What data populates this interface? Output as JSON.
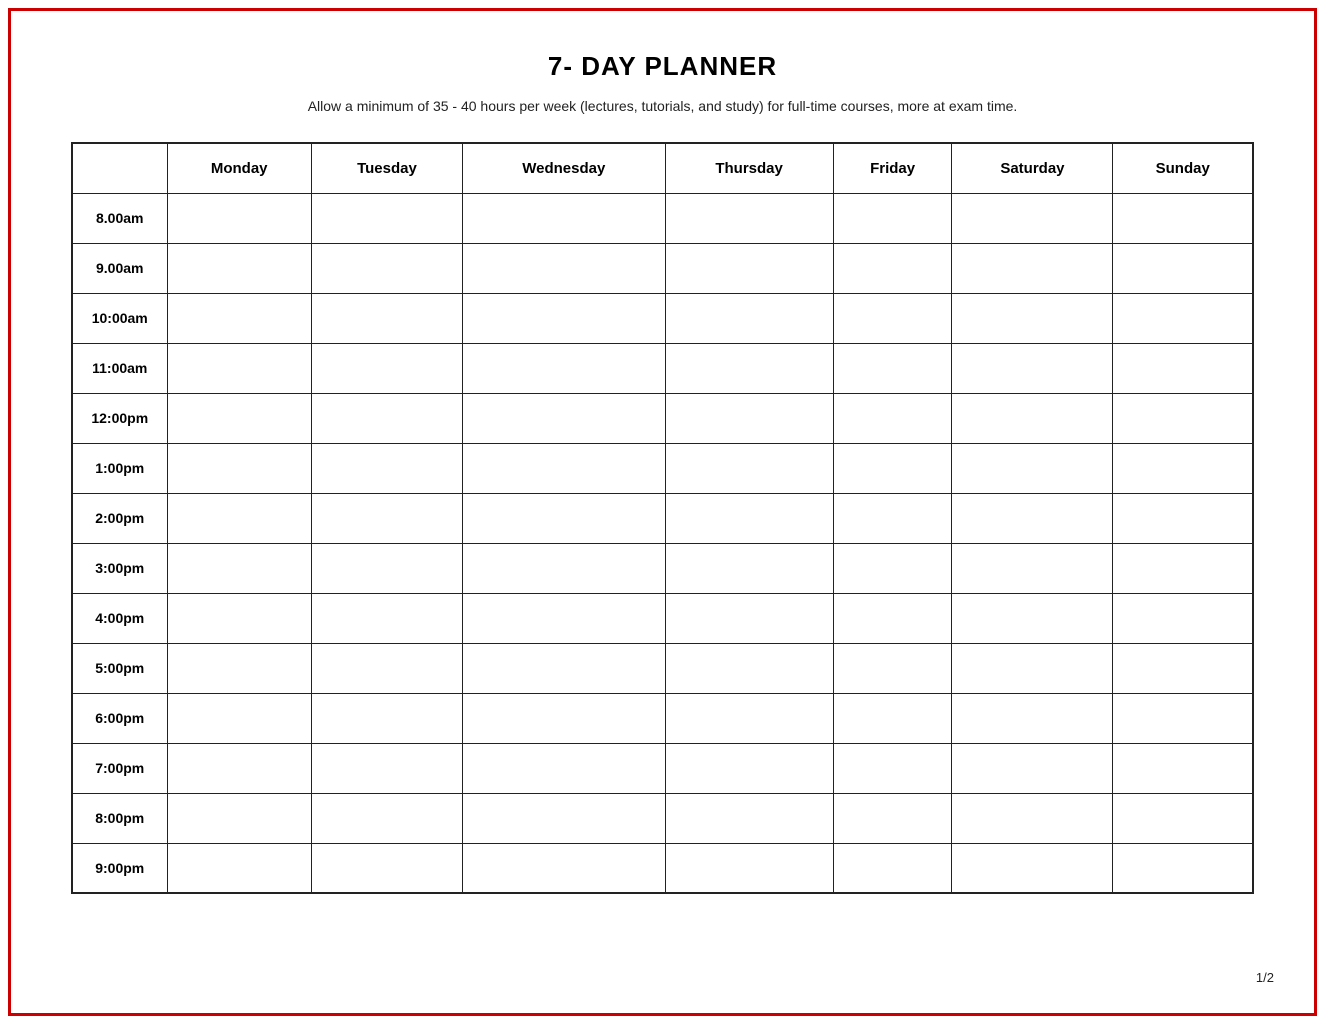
{
  "page": {
    "title": "7- DAY PLANNER",
    "subtitle": "Allow a minimum of 35 - 40 hours per week (lectures, tutorials, and study) for full-time courses, more at exam time.",
    "page_number": "1/2"
  },
  "table": {
    "days": [
      "Monday",
      "Tuesday",
      "Wednesday",
      "Thursday",
      "Friday",
      "Saturday",
      "Sunday"
    ],
    "times": [
      "8.00am",
      "9.00am",
      "10:00am",
      "11:00am",
      "12:00pm",
      "1:00pm",
      "2:00pm",
      "3:00pm",
      "4:00pm",
      "5:00pm",
      "6:00pm",
      "7:00pm",
      "8:00pm",
      "9:00pm"
    ]
  }
}
